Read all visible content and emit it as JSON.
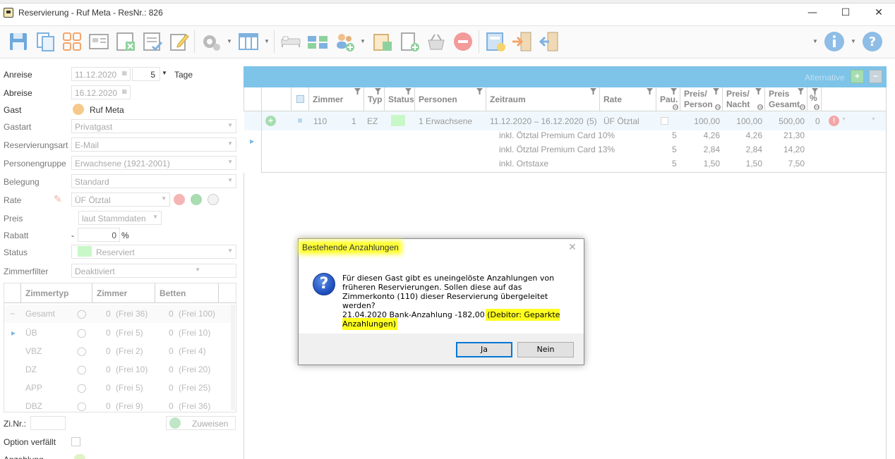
{
  "window": {
    "title": "Reservierung - Ruf Meta - ResNr.: 826",
    "minimize": "—",
    "maximize": "☐",
    "close": "✕"
  },
  "toolbar": {
    "icons": [
      "save-icon",
      "copy-icon",
      "grid-icon",
      "card-icon",
      "excel-icon",
      "report-icon",
      "edit-icon",
      "settings-icon",
      "columns-icon",
      "bed-icon",
      "transfer-icon",
      "guests-icon",
      "book-icon",
      "new-document-icon",
      "basket-icon",
      "cancel-icon",
      "invoice-icon",
      "checkin-icon",
      "checkout-icon",
      "info-icon",
      "help-icon"
    ]
  },
  "form": {
    "anreise": {
      "label": "Anreise",
      "date": "11.12.2020",
      "nights": "5",
      "unit": "Tage"
    },
    "abreise": {
      "label": "Abreise",
      "date": "16.12.2020"
    },
    "gast": {
      "label": "Gast",
      "value": "Ruf Meta"
    },
    "gastart": {
      "label": "Gastart",
      "value": "Privatgast"
    },
    "reservierungsart": {
      "label": "Reservierungsart",
      "value": "E-Mail"
    },
    "personengruppe": {
      "label": "Personengruppe",
      "value": "Erwachsene (1921-2001)"
    },
    "belegung": {
      "label": "Belegung",
      "value": "Standard"
    },
    "rate": {
      "label": "Rate",
      "value": "ÜF Ötztal"
    },
    "preis": {
      "label": "Preis",
      "value": "laut Stammdaten"
    },
    "rabatt": {
      "label": "Rabatt",
      "sign": "-",
      "value": "0",
      "unit": "%"
    },
    "status": {
      "label": "Status",
      "value": "Reserviert",
      "color": "#b6f5b6"
    },
    "zimmerfilter": {
      "label": "Zimmerfilter",
      "value": "Deaktiviert"
    },
    "zinr": {
      "label": "Zi.Nr.:",
      "button": "Zuweisen"
    },
    "option": {
      "label": "Option verfällt"
    },
    "cut_label": "Anzahlung"
  },
  "room_grid": {
    "headers": [
      "Zimmertyp",
      "Zimmer",
      "Betten"
    ],
    "rows": [
      {
        "type": "Gesamt",
        "rooms": "0",
        "free_rooms": "(Frei 36)",
        "beds": "0",
        "free_beds": "(Frei 100)",
        "prefix": "−"
      },
      {
        "type": "ÜB",
        "rooms": "0",
        "free_rooms": "(Frei 5)",
        "beds": "0",
        "free_beds": "(Frei 10)",
        "prefix": "▸"
      },
      {
        "type": "VBZ",
        "rooms": "0",
        "free_rooms": "(Frei 2)",
        "beds": "0",
        "free_beds": "(Frei 4)",
        "prefix": ""
      },
      {
        "type": "DZ",
        "rooms": "0",
        "free_rooms": "(Frei 10)",
        "beds": "0",
        "free_beds": "(Frei 20)",
        "prefix": ""
      },
      {
        "type": "APP",
        "rooms": "0",
        "free_rooms": "(Frei 5)",
        "beds": "0",
        "free_beds": "(Frei 25)",
        "prefix": ""
      },
      {
        "type": "DBZ",
        "rooms": "0",
        "free_rooms": "(Frei 9)",
        "beds": "0",
        "free_beds": "(Frei 36)",
        "prefix": ""
      }
    ]
  },
  "reservation_grid": {
    "alternative_label": "Alternative",
    "headers": {
      "zimmer": "Zimmer",
      "typ": "Typ",
      "status": "Status",
      "personen": "Personen",
      "zeitraum": "Zeitraum",
      "rate": "Rate",
      "pau": "Pau.",
      "preis_person_1": "Preis/",
      "preis_person_2": "Person",
      "preis_nacht_1": "Preis/",
      "preis_nacht_2": "Nacht",
      "preis_gesamt_1": "Preis",
      "preis_gesamt_2": "Gesamt",
      "percent": "%",
      "info": "(i)"
    },
    "row": {
      "zimmer": "110",
      "count": "1",
      "typ": "EZ",
      "status_color": "#b6f5b6",
      "personen": "1 Erwachsene",
      "zeitraum": "11.12.2020 – 16.12.2020",
      "nights": "(5)",
      "rate": "ÜF Ötztal",
      "preis_person": "100,00",
      "preis_nacht": "100,00",
      "preis_gesamt": "500,00",
      "percent": "0"
    },
    "details": [
      {
        "text": "inkl. Ötztal Premium Card 10%",
        "pau": "5",
        "person": "4,26",
        "nacht": "4,26",
        "gesamt": "21,30"
      },
      {
        "text": "inkl. Ötztal Premium Card 13%",
        "pau": "5",
        "person": "2,84",
        "nacht": "2,84",
        "gesamt": "14,20"
      },
      {
        "text": "inkl. Ortstaxe",
        "pau": "5",
        "person": "1,50",
        "nacht": "1,50",
        "gesamt": "7,50"
      }
    ]
  },
  "dialog": {
    "title": "Bestehende Anzahlungen",
    "icon": "?",
    "message": "Für diesen Gast gibt es uneingelöste Anzahlungen von früheren Reservierungen. Sollen diese auf das Zimmerkonto (110) dieser Reservierung übergeleitet werden?",
    "payment": "21.04.2020 Bank-Anzahlung -182,00",
    "debitor": "(Debitor: Geparkte Anzahlungen)",
    "yes": "Ja",
    "no": "Nein",
    "close": "✕"
  }
}
